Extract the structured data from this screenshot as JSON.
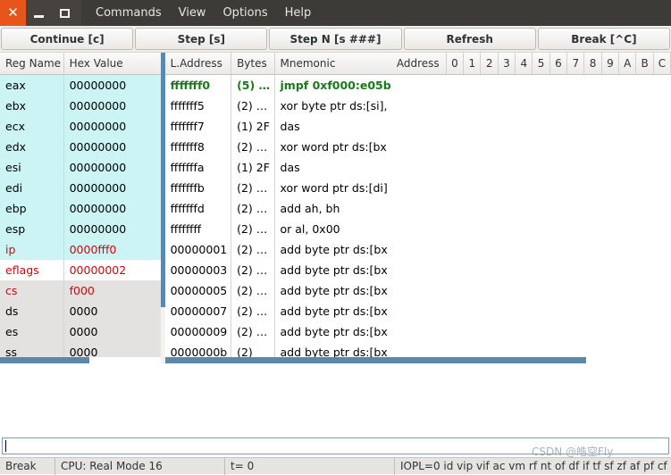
{
  "window": {
    "close_label": "✕",
    "minimize_label": "minimize",
    "maximize_label": "maximize",
    "menu": [
      "Commands",
      "View",
      "Options",
      "Help"
    ]
  },
  "toolbar": {
    "buttons": [
      "Continue [c]",
      "Step [s]",
      "Step N [s ###]",
      "Refresh",
      "Break [^C]"
    ]
  },
  "registers": {
    "headers": [
      "Reg Name",
      "Hex Value"
    ],
    "rows": [
      {
        "name": "eax",
        "value": "00000000",
        "bg": "cyan",
        "color": "black"
      },
      {
        "name": "ebx",
        "value": "00000000",
        "bg": "cyan",
        "color": "black"
      },
      {
        "name": "ecx",
        "value": "00000000",
        "bg": "cyan",
        "color": "black"
      },
      {
        "name": "edx",
        "value": "00000000",
        "bg": "cyan",
        "color": "black"
      },
      {
        "name": "esi",
        "value": "00000000",
        "bg": "cyan",
        "color": "black"
      },
      {
        "name": "edi",
        "value": "00000000",
        "bg": "cyan",
        "color": "black"
      },
      {
        "name": "ebp",
        "value": "00000000",
        "bg": "cyan",
        "color": "black"
      },
      {
        "name": "esp",
        "value": "00000000",
        "bg": "cyan",
        "color": "black"
      },
      {
        "name": "ip",
        "value": "0000fff0",
        "bg": "cyan",
        "color": "red"
      },
      {
        "name": "eflags",
        "value": "00000002",
        "bg": "white",
        "color": "red"
      },
      {
        "name": "cs",
        "value": "f000",
        "bg": "gray",
        "color": "red"
      },
      {
        "name": "ds",
        "value": "0000",
        "bg": "gray",
        "color": "black"
      },
      {
        "name": "es",
        "value": "0000",
        "bg": "gray",
        "color": "black"
      },
      {
        "name": "ss",
        "value": "0000",
        "bg": "gray",
        "color": "black"
      }
    ]
  },
  "disassembly": {
    "headers": [
      "L.Address",
      "Bytes",
      "Mnemonic"
    ],
    "rows": [
      {
        "address": "fffffff0",
        "bytes": "(5) …",
        "mnemonic": "jmpf 0xf000:e05b",
        "current": true
      },
      {
        "address": "fffffff5",
        "bytes": "(2) …",
        "mnemonic": "xor byte ptr ds:[si],",
        "current": false
      },
      {
        "address": "fffffff7",
        "bytes": "(1) 2F",
        "mnemonic": "das",
        "current": false
      },
      {
        "address": "fffffff8",
        "bytes": "(2) …",
        "mnemonic": "xor word ptr ds:[bx",
        "current": false
      },
      {
        "address": "fffffffa",
        "bytes": "(1) 2F",
        "mnemonic": "das",
        "current": false
      },
      {
        "address": "fffffffb",
        "bytes": "(2) …",
        "mnemonic": "xor word ptr ds:[di]",
        "current": false
      },
      {
        "address": "fffffffd",
        "bytes": "(2) …",
        "mnemonic": "add ah, bh",
        "current": false
      },
      {
        "address": "ffffffff",
        "bytes": "(2) …",
        "mnemonic": "or al, 0x00",
        "current": false
      },
      {
        "address": "00000001",
        "bytes": "(2) …",
        "mnemonic": "add byte ptr ds:[bx",
        "current": false
      },
      {
        "address": "00000003",
        "bytes": "(2) …",
        "mnemonic": "add byte ptr ds:[bx",
        "current": false
      },
      {
        "address": "00000005",
        "bytes": "(2) …",
        "mnemonic": "add byte ptr ds:[bx",
        "current": false
      },
      {
        "address": "00000007",
        "bytes": "(2) …",
        "mnemonic": "add byte ptr ds:[bx",
        "current": false
      },
      {
        "address": "00000009",
        "bytes": "(2) …",
        "mnemonic": "add byte ptr ds:[bx",
        "current": false
      },
      {
        "address": "0000000b",
        "bytes": "(2)",
        "mnemonic": "add byte ptr ds:[bx",
        "current": false
      }
    ]
  },
  "memory": {
    "headers": [
      "Address",
      "0",
      "1",
      "2",
      "3",
      "4",
      "5",
      "6",
      "7",
      "8",
      "9",
      "A",
      "B",
      "C"
    ],
    "rows": []
  },
  "command": {
    "value": "",
    "placeholder": ""
  },
  "statusbar": {
    "state": "Break",
    "cpu": "CPU: Real Mode 16",
    "ticks": "t= 0",
    "flags": "IOPL=0 id vip vif ac vm rf nt of df if tf sf zf af pf cf"
  },
  "watermark": {
    "text": "CSDN @皓空Fly"
  },
  "colors": {
    "titlebar": "#3c3b37",
    "close_button": "#e8551b",
    "register_highlight": "#cdf4f4",
    "changed_value": "#e00000",
    "current_instruction": "#1a7a1a",
    "scrollbar": "#5b89ac"
  }
}
